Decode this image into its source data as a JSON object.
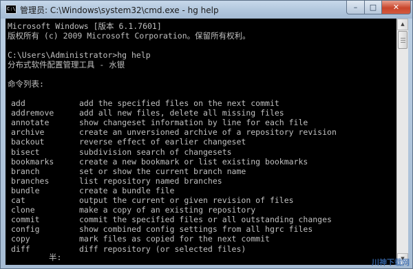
{
  "window": {
    "title": "管理员: C:\\Windows\\system32\\cmd.exe - hg  help",
    "icon_text": "C:\\",
    "minimize_glyph": "–",
    "maximize_glyph": "□",
    "close_glyph": "✕"
  },
  "console": {
    "header_lines": [
      "Microsoft Windows [版本 6.1.7601]",
      "版权所有 (c) 2009 Microsoft Corporation。保留所有权利。",
      "",
      "C:\\Users\\Administrator>hg help",
      "分布式软件配置管理工具 - 水银",
      "",
      "命令列表:",
      ""
    ],
    "commands": [
      {
        "name": "add",
        "desc": "add the specified files on the next commit"
      },
      {
        "name": "addremove",
        "desc": "add all new files, delete all missing files"
      },
      {
        "name": "annotate",
        "desc": "show changeset information by line for each file"
      },
      {
        "name": "archive",
        "desc": "create an unversioned archive of a repository revision"
      },
      {
        "name": "backout",
        "desc": "reverse effect of earlier changeset"
      },
      {
        "name": "bisect",
        "desc": "subdivision search of changesets"
      },
      {
        "name": "bookmarks",
        "desc": "create a new bookmark or list existing bookmarks"
      },
      {
        "name": "branch",
        "desc": "set or show the current branch name"
      },
      {
        "name": "branches",
        "desc": "list repository named branches"
      },
      {
        "name": "bundle",
        "desc": "create a bundle file"
      },
      {
        "name": "cat",
        "desc": "output the current or given revision of files"
      },
      {
        "name": "clone",
        "desc": "make a copy of an existing repository"
      },
      {
        "name": "commit",
        "desc": "commit the specified files or all outstanding changes"
      },
      {
        "name": "config",
        "desc": "show combined config settings from all hgrc files"
      },
      {
        "name": "copy",
        "desc": "mark files as copied for the next commit"
      },
      {
        "name": "diff",
        "desc": "diff repository (or selected files)"
      }
    ],
    "ime_status": "半:"
  },
  "scrollbar": {
    "up_arrow": "▲",
    "down_arrow": "▼"
  },
  "watermark": "川神下载网",
  "colors": {
    "console_bg": "#000000",
    "console_fg": "#c0c0c0"
  }
}
